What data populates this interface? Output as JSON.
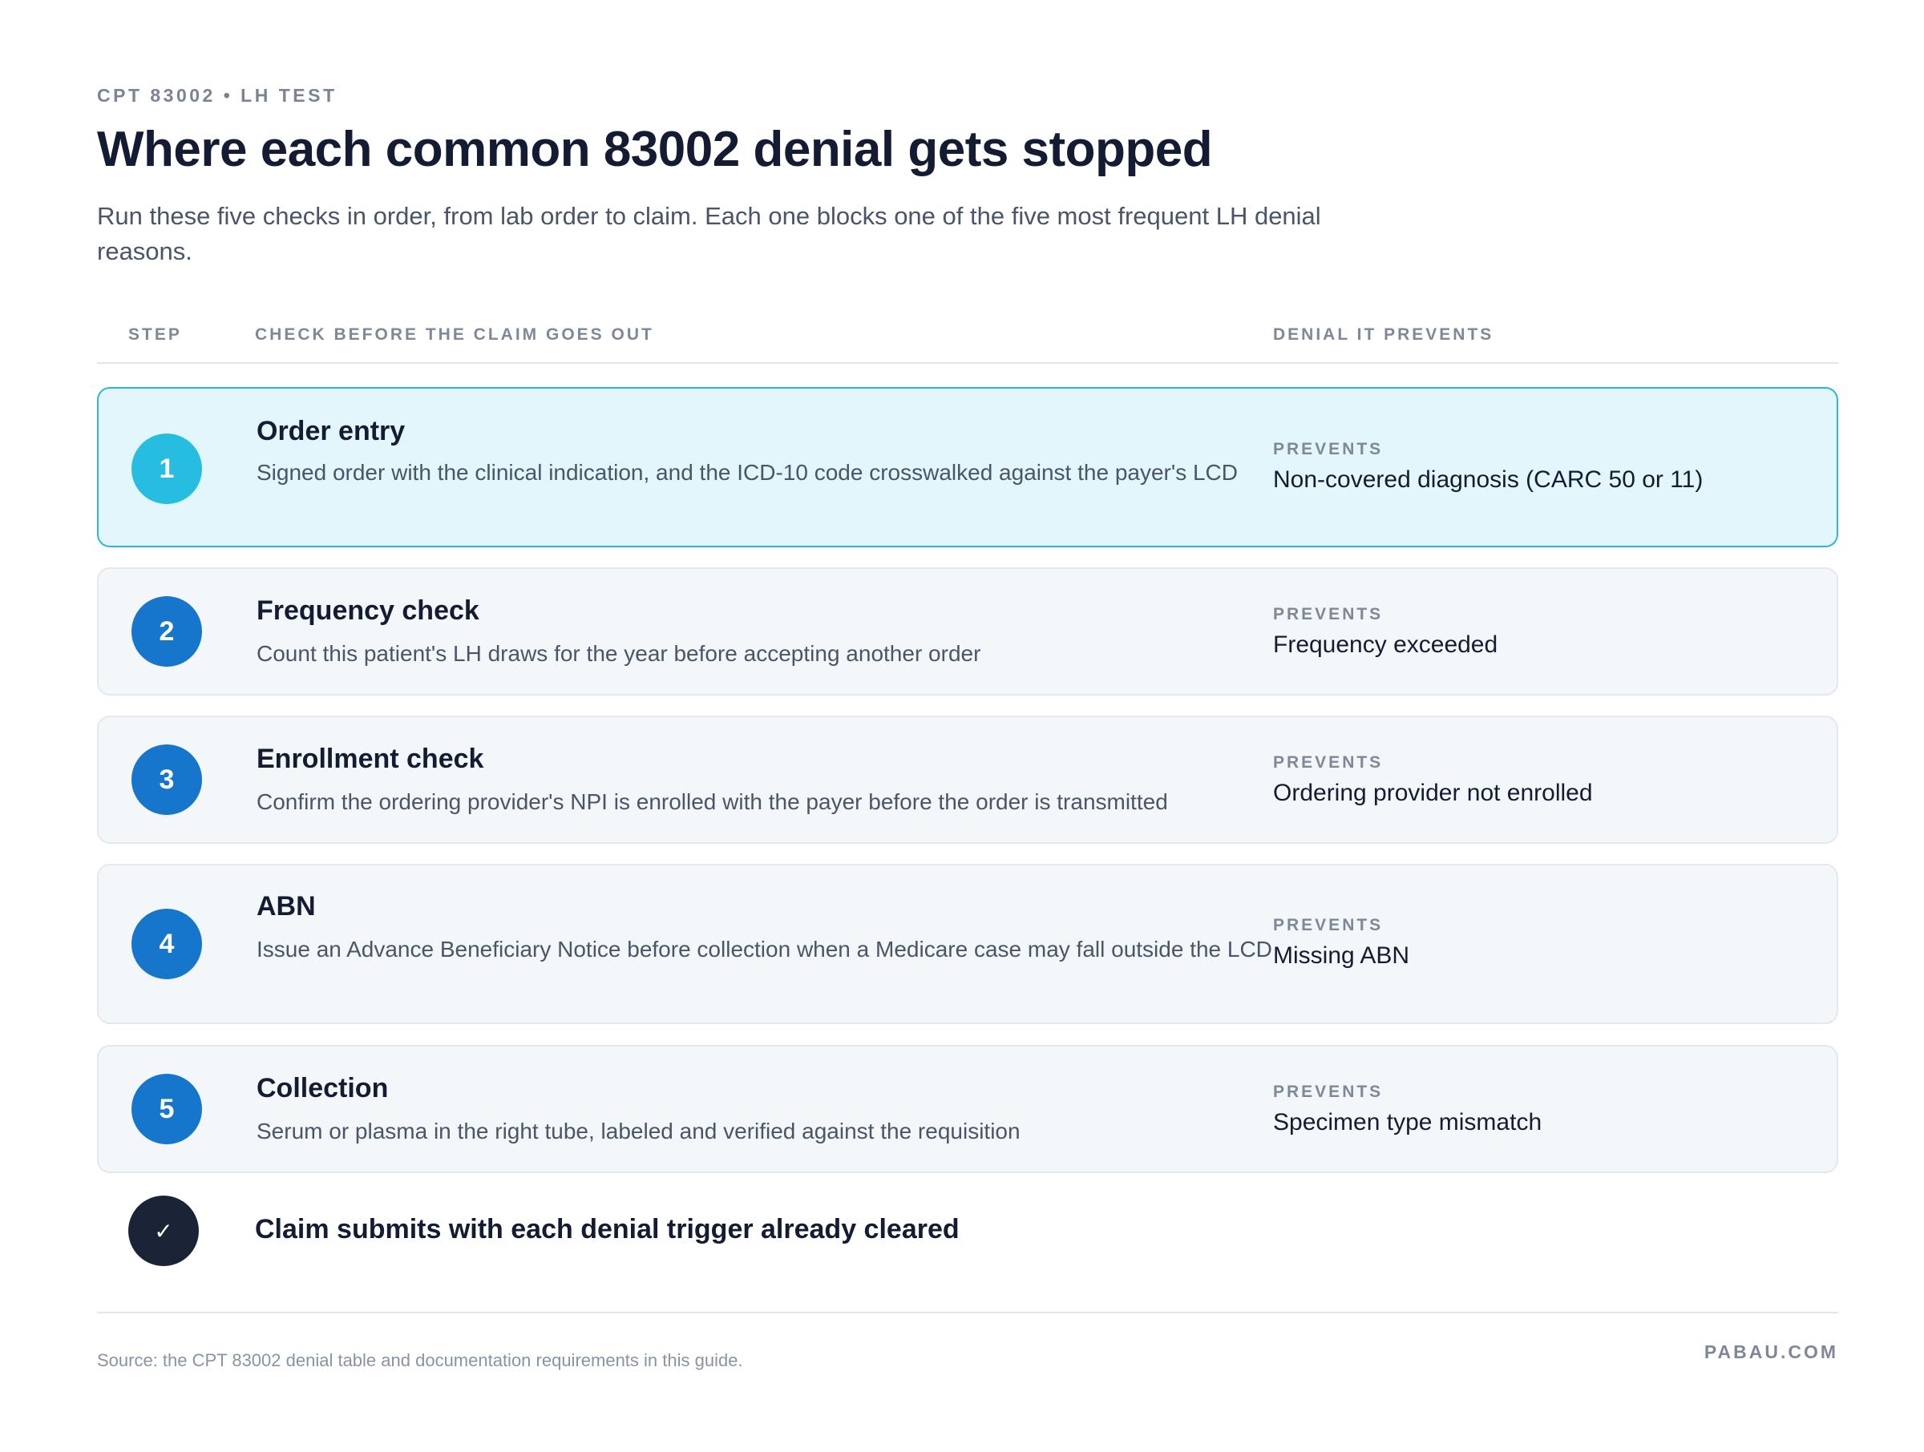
{
  "header": {
    "eyebrow": "CPT 83002 • LH TEST",
    "title": "Where each common 83002 denial gets stopped",
    "subtitle": "Run these five checks in order, from lab order to claim. Each one blocks one of the five most frequent LH denial reasons."
  },
  "columns": {
    "step": "STEP",
    "check": "CHECK BEFORE THE CLAIM GOES OUT",
    "denial": "DENIAL IT PREVENTS"
  },
  "steps": [
    {
      "number": "1",
      "title": "Order entry",
      "description": "Signed order with the clinical indication, and the ICD-10 code crosswalked against the payer's LCD",
      "prevents_label": "PREVENTS",
      "prevents": "Non-covered diagnosis (CARC 50 or 11)",
      "highlighted": true
    },
    {
      "number": "2",
      "title": "Frequency check",
      "description": "Count this patient's LH draws for the year before accepting another order",
      "prevents_label": "PREVENTS",
      "prevents": "Frequency exceeded",
      "highlighted": false
    },
    {
      "number": "3",
      "title": "Enrollment check",
      "description": "Confirm the ordering provider's NPI is enrolled with the payer before the order is transmitted",
      "prevents_label": "PREVENTS",
      "prevents": "Ordering provider not enrolled",
      "highlighted": false
    },
    {
      "number": "4",
      "title": "ABN",
      "description": "Issue an Advance Beneficiary Notice before collection when a Medicare case may fall outside the LCD",
      "prevents_label": "PREVENTS",
      "prevents": "Missing ABN",
      "highlighted": false
    },
    {
      "number": "5",
      "title": "Collection",
      "description": "Serum or plasma in the right tube, labeled and verified against the requisition",
      "prevents_label": "PREVENTS",
      "prevents": "Specimen type mismatch",
      "highlighted": false
    }
  ],
  "final": {
    "icon": "check-icon",
    "glyph": "✓",
    "text": "Claim submits with each denial trigger already cleared"
  },
  "footer": {
    "source": "Source: the CPT 83002 denial table and documentation requirements in this guide.",
    "brand": "PABAU.COM"
  },
  "colors": {
    "accent_highlight": "#26bde0",
    "accent_step": "#1576cc",
    "highlight_bg": "#e3f6fb",
    "row_bg": "#f4f7fa",
    "final_icon_bg": "#1b2436"
  }
}
